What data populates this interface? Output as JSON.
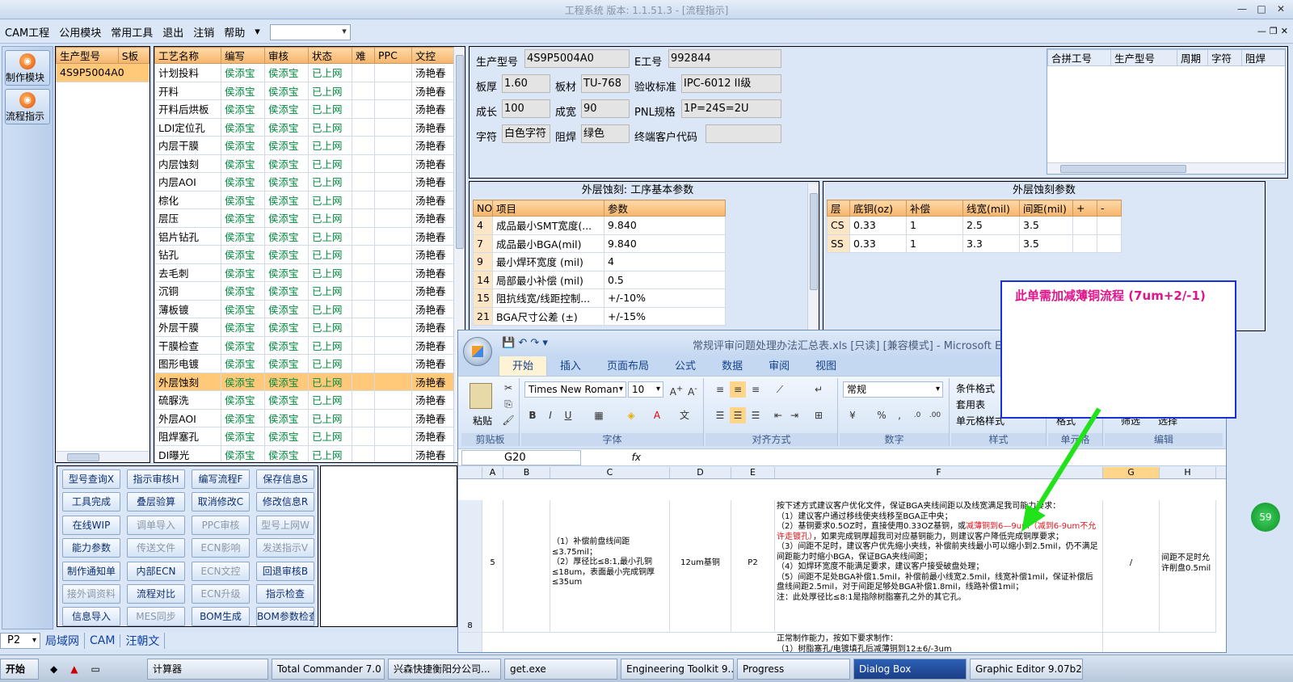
{
  "window": {
    "title": "工程系统  版本: 1.1.51.3 - [流程指示]"
  },
  "menu": {
    "items": [
      "CAM工程",
      "公用模块",
      "常用工具",
      "退出",
      "注销",
      "帮助"
    ],
    "more": "▾"
  },
  "nav": {
    "items": [
      "制作模块",
      "流程指示"
    ]
  },
  "products": {
    "headers": [
      "生产型号",
      "S板"
    ],
    "rows": [
      "4S9P5004A0"
    ]
  },
  "process": {
    "headers": [
      "工艺名称",
      "编写",
      "审核",
      "状态",
      "难",
      "PPC",
      "文控"
    ],
    "rows": [
      [
        "计划投料",
        "侯添宝",
        "侯添宝",
        "已上网",
        "",
        "",
        "汤艳春"
      ],
      [
        "开料",
        "侯添宝",
        "侯添宝",
        "已上网",
        "",
        "",
        "汤艳春"
      ],
      [
        "开料后烘板",
        "侯添宝",
        "侯添宝",
        "已上网",
        "",
        "",
        "汤艳春"
      ],
      [
        "LDI定位孔",
        "侯添宝",
        "侯添宝",
        "已上网",
        "",
        "",
        "汤艳春"
      ],
      [
        "内层干膜",
        "侯添宝",
        "侯添宝",
        "已上网",
        "",
        "",
        "汤艳春"
      ],
      [
        "内层蚀刻",
        "侯添宝",
        "侯添宝",
        "已上网",
        "",
        "",
        "汤艳春"
      ],
      [
        "内层AOI",
        "侯添宝",
        "侯添宝",
        "已上网",
        "",
        "",
        "汤艳春"
      ],
      [
        "棕化",
        "侯添宝",
        "侯添宝",
        "已上网",
        "",
        "",
        "汤艳春"
      ],
      [
        "层压",
        "侯添宝",
        "侯添宝",
        "已上网",
        "",
        "",
        "汤艳春"
      ],
      [
        "铝片钻孔",
        "侯添宝",
        "侯添宝",
        "已上网",
        "",
        "",
        "汤艳春"
      ],
      [
        "钻孔",
        "侯添宝",
        "侯添宝",
        "已上网",
        "",
        "",
        "汤艳春"
      ],
      [
        "去毛刺",
        "侯添宝",
        "侯添宝",
        "已上网",
        "",
        "",
        "汤艳春"
      ],
      [
        "沉铜",
        "侯添宝",
        "侯添宝",
        "已上网",
        "",
        "",
        "汤艳春"
      ],
      [
        "薄板镀",
        "侯添宝",
        "侯添宝",
        "已上网",
        "",
        "",
        "汤艳春"
      ],
      [
        "外层干膜",
        "侯添宝",
        "侯添宝",
        "已上网",
        "",
        "",
        "汤艳春"
      ],
      [
        "干膜检查",
        "侯添宝",
        "侯添宝",
        "已上网",
        "",
        "",
        "汤艳春"
      ],
      [
        "图形电镀",
        "侯添宝",
        "侯添宝",
        "已上网",
        "",
        "",
        "汤艳春"
      ],
      [
        "外层蚀刻",
        "侯添宝",
        "侯添宝",
        "已上网",
        "",
        "",
        "汤艳春"
      ],
      [
        "硫脲洗",
        "侯添宝",
        "侯添宝",
        "已上网",
        "",
        "",
        "汤艳春"
      ],
      [
        "外层AOI",
        "侯添宝",
        "侯添宝",
        "已上网",
        "",
        "",
        "汤艳春"
      ],
      [
        "阻焊塞孔",
        "侯添宝",
        "侯添宝",
        "已上网",
        "",
        "",
        "汤艳春"
      ],
      [
        "DI曝光",
        "侯添宝",
        "侯添宝",
        "已上网",
        "",
        "",
        "汤艳春"
      ]
    ],
    "selected_index": 17
  },
  "buttons": {
    "items": [
      {
        "label": "型号查询X",
        "enabled": true
      },
      {
        "label": "指示审核H",
        "enabled": true
      },
      {
        "label": "编写流程F",
        "enabled": true
      },
      {
        "label": "保存信息S",
        "enabled": true
      },
      {
        "label": "工具完成",
        "enabled": true
      },
      {
        "label": "叠层验算",
        "enabled": true
      },
      {
        "label": "取消修改C",
        "enabled": true
      },
      {
        "label": "修改信息R",
        "enabled": true
      },
      {
        "label": "在线WIP",
        "enabled": true
      },
      {
        "label": "调单导入",
        "enabled": false
      },
      {
        "label": "PPC审核",
        "enabled": false
      },
      {
        "label": "型号上网W",
        "enabled": false
      },
      {
        "label": "能力参数",
        "enabled": true
      },
      {
        "label": "传送文件",
        "enabled": false
      },
      {
        "label": "ECN影响",
        "enabled": false
      },
      {
        "label": "发送指示V",
        "enabled": false
      },
      {
        "label": "制作通知单",
        "enabled": true
      },
      {
        "label": "内部ECN",
        "enabled": true
      },
      {
        "label": "ECN文控",
        "enabled": false
      },
      {
        "label": "回退审核B",
        "enabled": true
      },
      {
        "label": "接外调资料",
        "enabled": false
      },
      {
        "label": "流程对比",
        "enabled": true
      },
      {
        "label": "ECN升级",
        "enabled": false
      },
      {
        "label": "指示检查",
        "enabled": true
      },
      {
        "label": "信息导入",
        "enabled": true
      },
      {
        "label": "MES同步",
        "enabled": false
      },
      {
        "label": "BOM生成",
        "enabled": true
      },
      {
        "label": "BOM参数检查",
        "enabled": true
      }
    ]
  },
  "bottom": {
    "selector": "P2",
    "tabs": [
      "局域网",
      "CAM",
      "汪朝文"
    ]
  },
  "info": {
    "model_label": "生产型号",
    "model_value": "4S9P5004A0",
    "e_label": "E工号",
    "e_value": "992844",
    "thickness_label": "板厚",
    "thickness_value": "1.60",
    "material_label": "板材",
    "material_value": "TU-768",
    "standard_label": "验收标准",
    "standard_value": "IPC-6012 II级",
    "length_label": "成长",
    "length_value": "100",
    "width_label": "成宽",
    "width_value": "90",
    "pnl_label": "PNL规格",
    "pnl_value": "1P=24S=2U",
    "char_label": "字符",
    "char_value": "白色字符",
    "mask_label": "阻焊",
    "mask_value": "绿色",
    "customer_label": "终端客户代码",
    "customer_value": ""
  },
  "merge": {
    "headers": [
      "合拼工号",
      "生产型号",
      "周期",
      "字符",
      "阻焊"
    ]
  },
  "etch_params": {
    "title": "外层蚀刻: 工序基本参数",
    "headers": [
      "NO",
      "项目",
      "参数"
    ],
    "rows": [
      [
        "4",
        "成品最小SMT宽度(...",
        "9.840"
      ],
      [
        "7",
        "成品最小BGA(mil)",
        "9.840"
      ],
      [
        "9",
        "最小焊环宽度 (mil)",
        "4"
      ],
      [
        "14",
        "局部最小补偿 (mil)",
        "0.5"
      ],
      [
        "15",
        "阻抗线宽/线距控制...",
        "+/-10%"
      ],
      [
        "21",
        "BGA尺寸公差 (±)",
        "+/-15%"
      ]
    ]
  },
  "etch_layer": {
    "title": "外层蚀刻参数",
    "headers": [
      "层",
      "底铜(oz)",
      "补偿",
      "线宽(mil)",
      "间距(mil)",
      "+",
      "-"
    ],
    "rows": [
      [
        "CS",
        "0.33",
        "1",
        "2.5",
        "3.5",
        "",
        ""
      ],
      [
        "SS",
        "0.33",
        "1",
        "3.3",
        "3.5",
        "",
        ""
      ]
    ]
  },
  "callout": {
    "text": "此单需加减薄铜流程 (7um+2/-1)"
  },
  "excel": {
    "title": "常规评审问题处理办法汇总表.xls  [只读]  [兼容模式] - Microsoft Excel",
    "tabs": [
      "开始",
      "插入",
      "页面布局",
      "公式",
      "数据",
      "审阅",
      "视图"
    ],
    "font": "Times New Roman",
    "size": "10",
    "number_format": "常规",
    "groups": [
      "剪贴板",
      "字体",
      "对齐方式",
      "数字",
      "样式",
      "单元格",
      "编辑"
    ],
    "paste": "粘贴",
    "style_items": [
      "条件格式",
      "套用表",
      "单元格样式"
    ],
    "cell_items": [
      "格式"
    ],
    "edit_items": [
      "筛选",
      "选择"
    ],
    "namebox": "G20",
    "fx": "fx",
    "columns": [
      "A",
      "B",
      "C",
      "D",
      "E",
      "F",
      "G",
      "H"
    ],
    "row_num": "8",
    "cellA": "5",
    "cellC": "（1）补偿前盘线间距≤3.75mil；\n（2）厚径比≤8:1,最小孔铜≤18um，表面最小完成铜厚≤35um",
    "cellD": "12um基铜",
    "cellE": "P2",
    "cellF_1": "按下述方式建议客户优化文件，保证BGA夹线间距以及线宽满足我司能力要求：\n（1）建议客户通过移线使夹线移至BGA正中央；\n（2）基铜要求0.5OZ时，直接使用0.33OZ基铜，或",
    "cellF_red1": "减薄铜到6—9um（减到6-9um不允许走镀孔）",
    "cellF_2": "，如果完成铜厚超我司对应基铜能力，则建议客户降低完成铜厚要求；\n（3）间距不足时，建议客户优先缩小夹线，补偿前夹线最小可以缩小到2.5mil，仍不满足间距能力时缩小BGA，保证BGA夹线间距；\n（4）如焊环宽度不能满足要求，建议客户接受破盘处理；\n（5）间距不足处BGA补偿1.5mil，补偿前最小线宽2.5mil，线宽补偿1mil，保证补偿后盘线间距2.5mil，对于间距足够处BGA补偿1.8mil，线路补偿1mil；\n注：此处厚径比≤8:1是指除树脂塞孔之外的其它孔。",
    "cellG": "/",
    "cellH": "间距不足时允许削盘0.5mil",
    "next_row": "正常制作能力，按如下要求制作：\n（1）树脂塞孔/电镀填孔后减薄铜到12±6/-3um"
  },
  "taskbar": {
    "start": "开始",
    "items": [
      "计算器",
      "Total Commander 7.0 ...",
      "兴森快捷衡阳分公司...",
      "get.exe",
      "Engineering Toolkit 9....",
      "Progress",
      "Dialog Box",
      "Graphic Editor 9.07b2 ..."
    ],
    "active_index": 6
  },
  "badge": "59"
}
